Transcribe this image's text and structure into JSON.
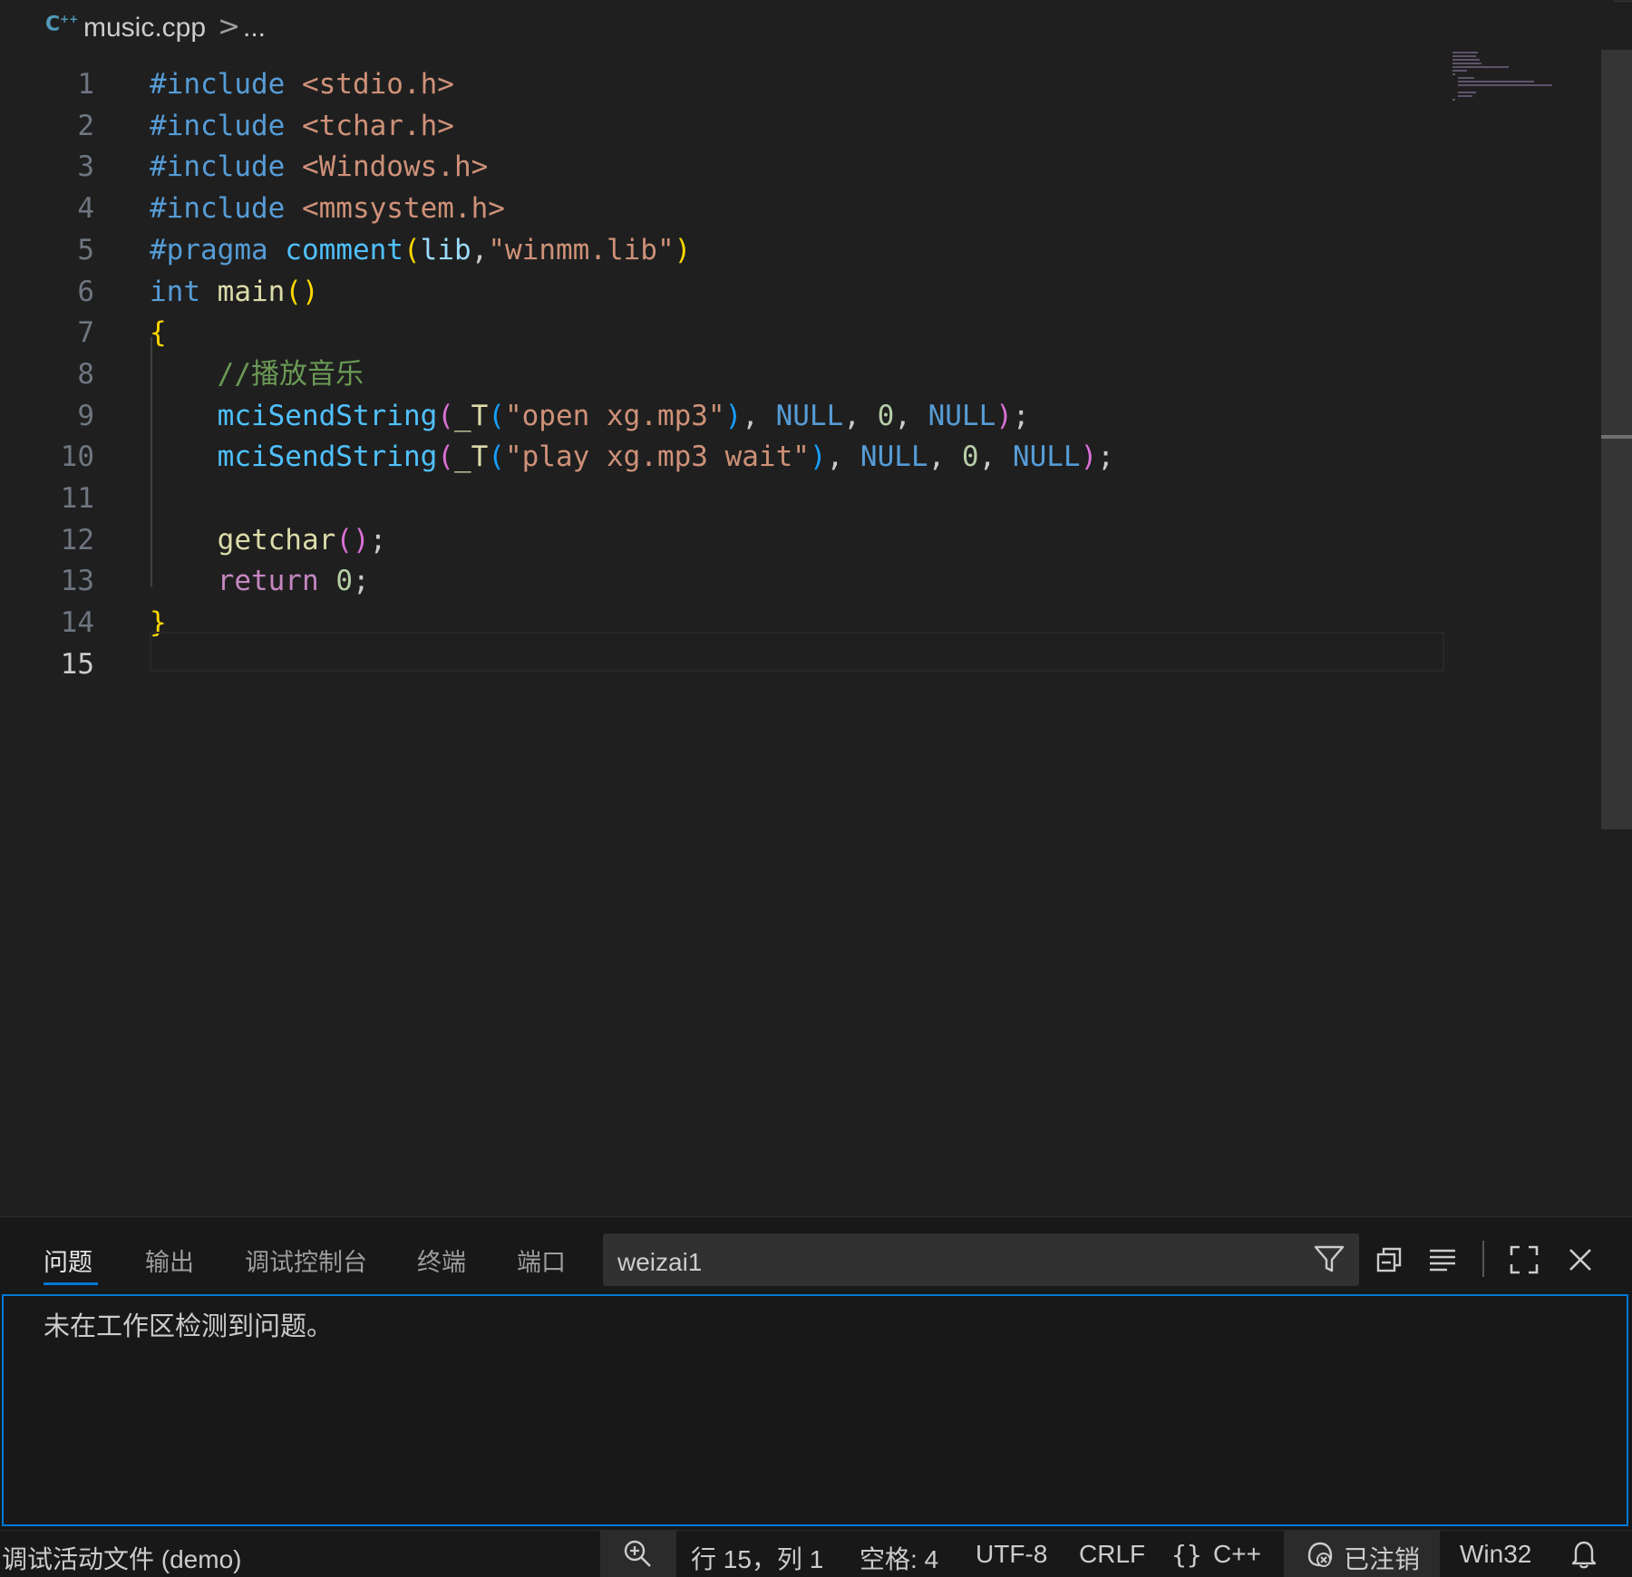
{
  "breadcrumb": {
    "file": "music.cpp",
    "separator": ">",
    "more": "..."
  },
  "editor": {
    "line_numbers": [
      "1",
      "2",
      "3",
      "4",
      "5",
      "6",
      "7",
      "8",
      "9",
      "10",
      "11",
      "12",
      "13",
      "14",
      "15"
    ],
    "active_line": "15",
    "lines": [
      [
        [
          "mac",
          "#include"
        ],
        [
          "pun",
          " "
        ],
        [
          "str",
          "<stdio.h>"
        ]
      ],
      [
        [
          "mac",
          "#include"
        ],
        [
          "pun",
          " "
        ],
        [
          "str",
          "<tchar.h>"
        ]
      ],
      [
        [
          "mac",
          "#include"
        ],
        [
          "pun",
          " "
        ],
        [
          "str",
          "<Windows.h>"
        ]
      ],
      [
        [
          "mac",
          "#include"
        ],
        [
          "pun",
          " "
        ],
        [
          "str",
          "<mmsystem.h>"
        ]
      ],
      [
        [
          "mac",
          "#pragma"
        ],
        [
          "pun",
          " "
        ],
        [
          "def",
          "comment"
        ],
        [
          "br1",
          "("
        ],
        [
          "var",
          "lib"
        ],
        [
          "pun",
          ","
        ],
        [
          "str",
          "\"winmm.lib\""
        ],
        [
          "br1",
          ")"
        ]
      ],
      [
        [
          "type",
          "int"
        ],
        [
          "pun",
          " "
        ],
        [
          "fn",
          "main"
        ],
        [
          "br1",
          "()"
        ]
      ],
      [
        [
          "br1",
          "{"
        ]
      ],
      [
        [
          "pun",
          "    "
        ],
        [
          "cm",
          "//播放音乐"
        ]
      ],
      [
        [
          "pun",
          "    "
        ],
        [
          "def",
          "mciSendString"
        ],
        [
          "br2",
          "("
        ],
        [
          "fn",
          "_T"
        ],
        [
          "br3",
          "("
        ],
        [
          "str",
          "\"open xg.mp3\""
        ],
        [
          "br3",
          ")"
        ],
        [
          "pun",
          ", "
        ],
        [
          "type",
          "NULL"
        ],
        [
          "pun",
          ", "
        ],
        [
          "num",
          "0"
        ],
        [
          "pun",
          ", "
        ],
        [
          "type",
          "NULL"
        ],
        [
          "br2",
          ")"
        ],
        [
          "pun",
          ";"
        ]
      ],
      [
        [
          "pun",
          "    "
        ],
        [
          "def",
          "mciSendString"
        ],
        [
          "br2",
          "("
        ],
        [
          "fn",
          "_T"
        ],
        [
          "br3",
          "("
        ],
        [
          "str",
          "\"play xg.mp3 wait\""
        ],
        [
          "br3",
          ")"
        ],
        [
          "pun",
          ", "
        ],
        [
          "type",
          "NULL"
        ],
        [
          "pun",
          ", "
        ],
        [
          "num",
          "0"
        ],
        [
          "pun",
          ", "
        ],
        [
          "type",
          "NULL"
        ],
        [
          "br2",
          ")"
        ],
        [
          "pun",
          ";"
        ]
      ],
      [],
      [
        [
          "pun",
          "    "
        ],
        [
          "fn",
          "getchar"
        ],
        [
          "br2",
          "()"
        ],
        [
          "pun",
          ";"
        ]
      ],
      [
        [
          "pun",
          "    "
        ],
        [
          "ctl",
          "return"
        ],
        [
          "pun",
          " "
        ],
        [
          "num",
          "0"
        ],
        [
          "pun",
          ";"
        ]
      ],
      [
        [
          "br1",
          "}"
        ]
      ],
      []
    ]
  },
  "panel": {
    "tabs": [
      "问题",
      "输出",
      "调试控制台",
      "终端",
      "端口"
    ],
    "active_tab": "问题",
    "filter_value": "weizai1",
    "message": "未在工作区检测到问题。"
  },
  "statusbar": {
    "debug": "调试活动文件 (demo)",
    "zoom_icon": "zoom-in-icon",
    "position": "行 15，列 1",
    "indent": "空格: 4",
    "encoding": "UTF-8",
    "eol": "CRLF",
    "language": "C++",
    "account": "已注销",
    "platform": "Win32",
    "bell_icon": "bell-icon"
  },
  "colors": {
    "accent": "#0078d4",
    "editor_bg": "#1f1f1f",
    "panel_bg": "#181818"
  }
}
